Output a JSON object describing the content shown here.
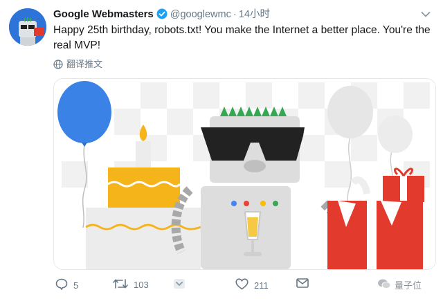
{
  "tweet": {
    "author_name": "Google Webmasters",
    "handle": "@googlewmc",
    "separator": "·",
    "time": "14小时",
    "text": "Happy 25th birthday, robots.txt! You make the Internet a better place. You're the real MVP!",
    "translate_label": "翻译推文"
  },
  "icons": {
    "verified": "verified-badge-icon",
    "caret": "chevron-down-icon",
    "translate": "globe-icon",
    "reply": "reply-icon",
    "retweet": "retweet-icon",
    "share": "share-icon",
    "like": "heart-icon",
    "dm": "envelope-icon"
  },
  "actions": {
    "reply_count": "5",
    "retweet_count": "103",
    "like_count": "211"
  },
  "watermark": {
    "text": "量子位"
  },
  "colors": {
    "accent": "#1da1f2",
    "balloon_blue": "#3b82e6",
    "cake_yellow": "#f6b41b",
    "gift_red": "#e23b2e",
    "mohawk_green": "#34a853"
  }
}
